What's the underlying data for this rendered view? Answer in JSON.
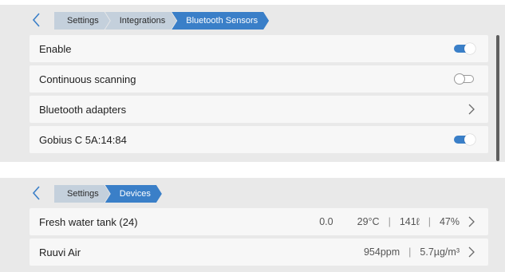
{
  "colors": {
    "accent": "#3a7fc8",
    "panel_bg": "#e9e9e9",
    "row_bg": "#f7f7f7",
    "crumb_bg": "#c4d0dc"
  },
  "top_panel": {
    "breadcrumb": [
      "Settings",
      "Integrations",
      "Bluetooth Sensors"
    ],
    "rows": {
      "enable": {
        "label": "Enable",
        "toggle": "on"
      },
      "continuous": {
        "label": "Continuous scanning",
        "toggle": "off"
      },
      "adapters": {
        "label": "Bluetooth adapters"
      },
      "gobius": {
        "label": "Gobius C 5A:14:84",
        "toggle": "on"
      }
    }
  },
  "bottom_panel": {
    "breadcrumb": [
      "Settings",
      "Devices"
    ],
    "rows": {
      "tank": {
        "label": "Fresh water tank (24)",
        "value": "0.0",
        "temperature": "29°C",
        "volume": "141ℓ",
        "percent": "47%"
      },
      "ruuvi": {
        "label": "Ruuvi Air",
        "co2": "954ppm",
        "pm": "5.7µg/m³"
      }
    }
  },
  "icons": {
    "back": "chevron-left-icon",
    "row_arrow": "chevron-right-icon"
  }
}
